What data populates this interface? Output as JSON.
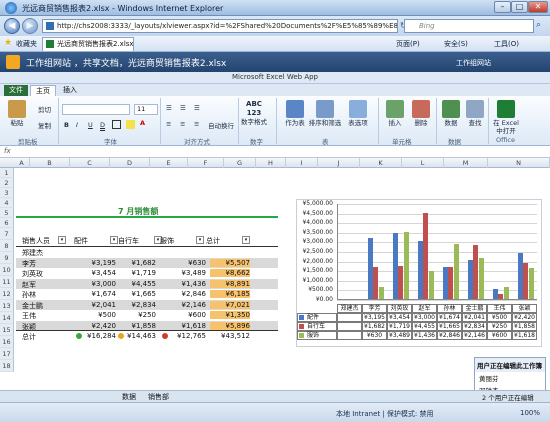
{
  "window": {
    "title": "光远商贸销售报表2.xlsx - Windows Internet Explorer"
  },
  "address_bar": {
    "url": "http://chs2008:3333/_layouts/xlviewer.aspx?id=%2FShared%20Documents%2F%E5%85%89%E8%BF%9C",
    "search_placeholder": "Bing"
  },
  "favorites": {
    "label": "收藏夹",
    "tab_label": "光远商贸销售报表2.xlsx",
    "page_menu": "页面(P)",
    "safety_menu": "安全(S)",
    "tools_menu": "工具(O)"
  },
  "sharepoint": {
    "site_title": "工作组网站 ，共享文档，光远商贸销售报表2.xlsx",
    "site_link": "工作组网站"
  },
  "app": {
    "title": "Microsoft Excel Web App"
  },
  "ribbon_tabs": [
    "文件",
    "主页",
    "插入"
  ],
  "ribbon": {
    "paste": "粘贴",
    "cut": "剪切",
    "copy": "复制",
    "font_size": "11",
    "bold": "B",
    "italic": "I",
    "underline": "U",
    "dunderline": "D",
    "wrap": "自动换行",
    "number_format": "数字格式",
    "number_sample": "ABC 123",
    "as_table": "作为表",
    "sort_filter": "排序和筛选",
    "table_options": "表选项",
    "insert": "插入",
    "delete": "删除",
    "data": "数据",
    "find": "查找",
    "open_in_excel": "在 Excel 中打开",
    "groups": [
      "剪贴板",
      "字体",
      "对齐方式",
      "数字",
      "表",
      "单元格",
      "数据",
      "Office"
    ]
  },
  "formula_bar": {
    "label": "fx"
  },
  "columns": [
    "A",
    "B",
    "C",
    "D",
    "E",
    "F",
    "G",
    "H",
    "I",
    "J",
    "K",
    "L",
    "M",
    "N"
  ],
  "rows": [
    "1",
    "2",
    "3",
    "4",
    "5",
    "6",
    "7",
    "8",
    "9",
    "10",
    "11",
    "12",
    "13",
    "14",
    "15",
    "16",
    "17",
    "18"
  ],
  "sheet": {
    "title": "7 月销售额",
    "headers": [
      "销售人员",
      "配件",
      "自行车",
      "服饰",
      "总计"
    ],
    "data_rows": [
      {
        "name": "郑建杰",
        "c1": "",
        "c2": "",
        "c3": "",
        "total": ""
      },
      {
        "name": "李芳",
        "c1": "¥3,195",
        "c2": "¥1,682",
        "c3": "¥630",
        "total": "¥5,507"
      },
      {
        "name": "刘英玫",
        "c1": "¥3,454",
        "c2": "¥1,719",
        "c3": "¥3,489",
        "total": "¥8,662"
      },
      {
        "name": "赵军",
        "c1": "¥3,000",
        "c2": "¥4,455",
        "c3": "¥1,436",
        "total": "¥8,891"
      },
      {
        "name": "孙林",
        "c1": "¥1,674",
        "c2": "¥1,665",
        "c3": "¥2,846",
        "total": "¥6,185"
      },
      {
        "name": "金士鹏",
        "c1": "¥2,041",
        "c2": "¥2,834",
        "c3": "¥2,146",
        "total": "¥7,021"
      },
      {
        "name": "王伟",
        "c1": "¥500",
        "c2": "¥250",
        "c3": "¥600",
        "total": "¥1,350"
      },
      {
        "name": "张颖",
        "c1": "¥2,420",
        "c2": "¥1,858",
        "c3": "¥1,618",
        "total": "¥5,896"
      },
      {
        "name": "总计",
        "c1": "¥16,284",
        "c2": "¥14,463",
        "c3": "¥12,765",
        "total": "¥43,512"
      }
    ],
    "tabs": [
      "数据",
      "销售部"
    ]
  },
  "chart_data": {
    "type": "bar",
    "categories": [
      "郑建杰",
      "李芳",
      "刘英玫",
      "赵军",
      "孙林",
      "金士鹏",
      "王伟",
      "张颖"
    ],
    "series": [
      {
        "name": "配件",
        "values": [
          0,
          3195,
          3454,
          3000,
          1674,
          2041,
          500,
          2420
        ],
        "labels": [
          "",
          "¥3,195",
          "¥3,454",
          "¥3,000",
          "¥1,674",
          "¥2,041",
          "¥500",
          "¥2,420"
        ]
      },
      {
        "name": "自行车",
        "values": [
          0,
          1682,
          1719,
          4455,
          1665,
          2834,
          250,
          1858
        ],
        "labels": [
          "",
          "¥1,682",
          "¥1,719",
          "¥4,455",
          "¥1,665",
          "¥2,834",
          "¥250",
          "¥1,858"
        ]
      },
      {
        "name": "服饰",
        "values": [
          0,
          630,
          3489,
          1436,
          2846,
          2146,
          600,
          1618
        ],
        "labels": [
          "",
          "¥630",
          "¥3,489",
          "¥1,436",
          "¥2,846",
          "¥2,146",
          "¥600",
          "¥1,618"
        ]
      }
    ],
    "yticks": [
      "¥5,000.00",
      "¥4,500.00",
      "¥4,000.00",
      "¥3,500.00",
      "¥3,000.00",
      "¥2,500.00",
      "¥2,000.00",
      "¥1,500.00",
      "¥1,000.00",
      "¥500.00",
      "¥0.00"
    ],
    "ylim": [
      0,
      5000
    ],
    "colors": [
      "#4a78c2",
      "#c0504d",
      "#9bbb59"
    ],
    "legend": "table-left",
    "grid": true
  },
  "editors": {
    "title": "用户正在编辑此工作簿",
    "users": [
      "黄丽芬",
      "邓雄杰"
    ],
    "status": "2 个用户正在编辑"
  },
  "statusbar": {
    "zone": "本地 Intranet | 保护模式: 禁用",
    "zoom": "100%"
  }
}
